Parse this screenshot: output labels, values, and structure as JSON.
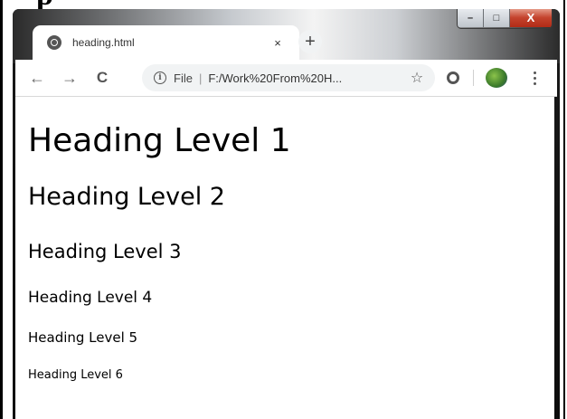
{
  "page": {
    "cropped_heading_fragment": "p"
  },
  "browser": {
    "tab": {
      "title": "heading.html",
      "favicon": "globe-icon",
      "close_glyph": "×"
    },
    "new_tab_glyph": "+",
    "caption": {
      "minimize": "–",
      "maximize": "□",
      "close": "X"
    },
    "toolbar": {
      "back_glyph": "←",
      "forward_glyph": "→",
      "reload_glyph": "C",
      "address": {
        "info_glyph": "i",
        "scheme": "File",
        "separator": "|",
        "url": "F:/Work%20From%20H...",
        "star_glyph": "☆"
      }
    }
  },
  "document": {
    "headings": [
      "Heading Level 1",
      "Heading Level 2",
      "Heading Level 3",
      "Heading Level 4",
      "Heading Level 5",
      "Heading Level 6"
    ]
  },
  "colors": {
    "window_frame": "#0c0c0c",
    "tab_background": "#ffffff",
    "omnibox_background": "#f1f3f4",
    "close_button": "#c4432d"
  }
}
